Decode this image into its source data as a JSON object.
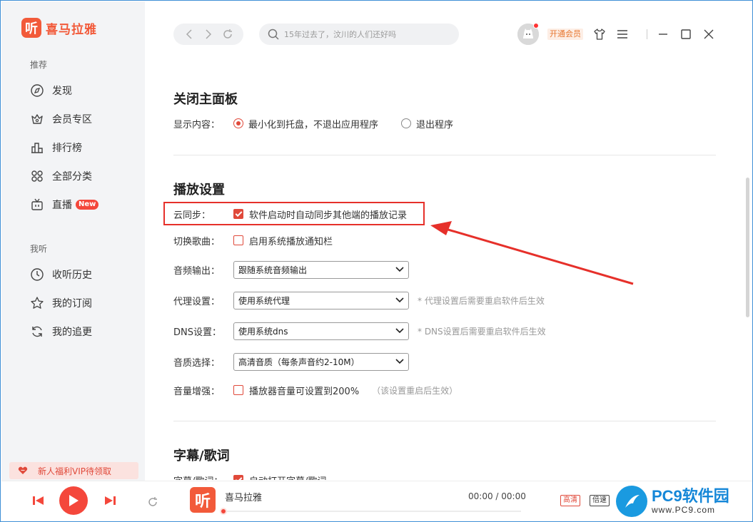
{
  "app": {
    "logo_mark": "听",
    "logo_text": "喜马拉雅"
  },
  "sidebar": {
    "section_recommend": "推荐",
    "recommend_items": [
      {
        "label": "发现",
        "icon": "compass-icon"
      },
      {
        "label": "会员专区",
        "icon": "crown-icon"
      },
      {
        "label": "排行榜",
        "icon": "ranking-icon"
      },
      {
        "label": "全部分类",
        "icon": "grid-icon"
      },
      {
        "label": "直播",
        "icon": "tv-icon",
        "badge": "New"
      }
    ],
    "section_mine": "我听",
    "mine_items": [
      {
        "label": "收听历史",
        "icon": "clock-icon"
      },
      {
        "label": "我的订阅",
        "icon": "star-icon"
      },
      {
        "label": "我的追更",
        "icon": "refresh-icon"
      }
    ],
    "vip_promo": "新人福利VIP待领取"
  },
  "header": {
    "search_placeholder": "15年过去了，汶川的人们还好吗",
    "vip_button": "开通会员"
  },
  "settings": {
    "close_panel": {
      "title": "关闭主面板",
      "label": "显示内容：",
      "option_minimize": "最小化到托盘，不退出应用程序",
      "option_exit": "退出程序",
      "selected": "minimize"
    },
    "playback": {
      "title": "播放设置",
      "cloud_sync_label": "云同步：",
      "cloud_sync_text": "软件启动时自动同步其他端的播放记录",
      "cloud_sync_checked": true,
      "switch_song_label": "切换歌曲：",
      "switch_song_text": "启用系统播放通知栏",
      "switch_song_checked": false,
      "audio_output_label": "音频输出：",
      "audio_output_value": "跟随系统音频输出",
      "proxy_label": "代理设置：",
      "proxy_value": "使用系统代理",
      "proxy_note": "* 代理设置后需要重启软件后生效",
      "dns_label": "DNS设置：",
      "dns_value": "使用系统dns",
      "dns_note": "* DNS设置后需要重启软件后生效",
      "quality_label": "音质选择：",
      "quality_value": "高清音质（每条声音约2-10M）",
      "volume_label": "音量增强：",
      "volume_text": "播放器音量可设置到200%",
      "volume_hint": "（该设置重启后生效）",
      "volume_checked": false
    },
    "lyrics": {
      "title": "字幕/歌词",
      "label": "字幕/歌词：",
      "text": "自动打开字幕/歌词",
      "checked": true
    }
  },
  "player": {
    "cover_mark": "听",
    "title": "喜马拉雅",
    "time": "00:00 / 00:00",
    "quality_tag": "高清",
    "speed_tag": "倍速",
    "progress": 0
  },
  "watermark": {
    "main": "PC9软件园",
    "sub": "www.PC9.com"
  },
  "colors": {
    "accent": "#f4473b",
    "highlight_box": "#e6302a"
  }
}
